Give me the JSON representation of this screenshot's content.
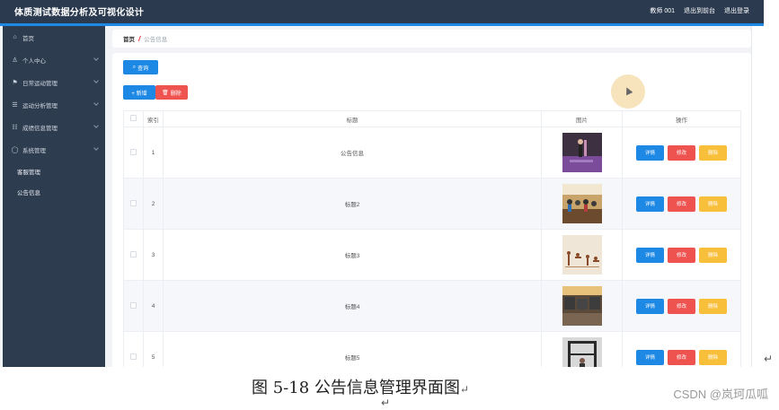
{
  "app": {
    "title": "体质测试数据分析及可视化设计"
  },
  "topbar": {
    "user": "教师 001",
    "back_link": "退出到前台",
    "logout_link": "退出登录"
  },
  "sidebar": {
    "items": [
      {
        "label": "首页",
        "icon": "home-icon"
      },
      {
        "label": "个人中心",
        "icon": "user-icon"
      },
      {
        "label": "日常运动管理",
        "icon": "flag-icon"
      },
      {
        "label": "运动分析管理",
        "icon": "list-icon"
      },
      {
        "label": "成绩信息管理",
        "icon": "sliders-icon"
      },
      {
        "label": "系统管理",
        "icon": "circle-icon"
      }
    ],
    "sub_items": [
      {
        "label": "客服管理"
      },
      {
        "label": "公告信息"
      }
    ]
  },
  "breadcrumb": {
    "home": "首页",
    "separator": "/",
    "current": "公告信息"
  },
  "toolbar": {
    "search_label": "查询",
    "add_label": "+ 新增",
    "delete_label": "删除"
  },
  "table": {
    "headers": {
      "index": "索引",
      "title": "标题",
      "image": "图片",
      "actions": "操作"
    },
    "rows": [
      {
        "index": "1",
        "title": "公告信息",
        "image": "yoga-photo-purple"
      },
      {
        "index": "2",
        "title": "标题2",
        "image": "gym-class-photo"
      },
      {
        "index": "3",
        "title": "标题3",
        "image": "yoga-poster"
      },
      {
        "index": "4",
        "title": "标题4",
        "image": "gym-interior-photo"
      },
      {
        "index": "5",
        "title": "标题5",
        "image": "weight-rack-photo"
      }
    ],
    "row_actions": {
      "detail": "详情",
      "edit": "修改",
      "delete": "删除"
    }
  },
  "caption": {
    "text": "图 5-18 公告信息管理界面图",
    "return_mark": "↵",
    "watermark": "CSDN @岚珂瓜呱"
  },
  "colors": {
    "topbar": "#2b3a4f",
    "sidebar": "#2e3c50",
    "accent": "#1e88e5",
    "danger": "#ef5350",
    "warning": "#f8bf3a"
  }
}
